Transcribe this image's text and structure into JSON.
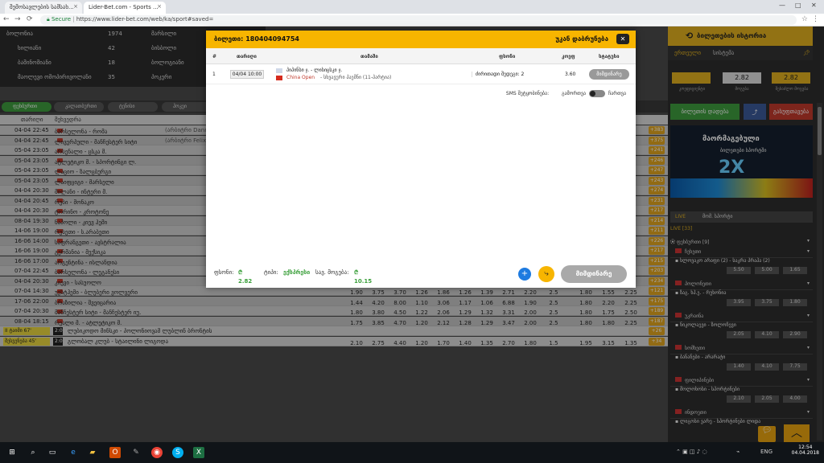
{
  "browser": {
    "tabs": [
      {
        "title": "შემოსავლების სამსახ..."
      },
      {
        "title": "Lider-Bet.com - Sports ..."
      }
    ],
    "address": {
      "secure": "Secure",
      "url": "https://www.lider-bet.com/web/ka/sport#saved="
    }
  },
  "topgrid": [
    {
      "name": "ბოლონია",
      "num": "1974"
    },
    {
      "name": "ხილიანი",
      "num": "42"
    },
    {
      "name": "ბამინომიანი",
      "num": "18"
    },
    {
      "name": "მაოლევი ომოპირივოლანი",
      "num": "35"
    }
  ],
  "topgrid_right": [
    "მარსილი",
    "ბისბოლი",
    "ბოლოგიანი",
    "პოკერი"
  ],
  "sport_tabs": [
    "ფეხბურთი",
    "კალათბურთი",
    "ტენისი",
    "ჰოკეი"
  ],
  "table_header": {
    "date": "თარიღი",
    "match": "შეხვედრა"
  },
  "matches": [
    {
      "date": "04-04 22:45",
      "name": "ბარსელონა - რომა",
      "note": "(არბიტრი Danny Makkelie)",
      "plus": "+383"
    },
    {
      "date": "04-04 22:45",
      "name": "ლივერპული - მანჩესტერ სიტი",
      "note": "(არბიტრი Felix Brych)",
      "plus": "+375"
    },
    {
      "date": "05-04 23:05",
      "name": "არსენალი - ცსკა მ.",
      "note": "",
      "plus": "+241"
    },
    {
      "date": "05-04 23:05",
      "name": "ატლეტიკო მ. - სპორტინგი ლ.",
      "note": "",
      "plus": "+246"
    },
    {
      "date": "05-04 23:05",
      "name": "ლაციო - ზალცბურგი",
      "note": "",
      "plus": "+247"
    },
    {
      "date": "05-04 23:05",
      "name": "ლაიფციგი - მარსელი",
      "note": "",
      "plus": "+243"
    },
    {
      "date": "04-04 20:30",
      "name": "მილანი - ინტერი მ.",
      "note": "",
      "plus": "+274"
    },
    {
      "date": "04-04 20:45",
      "name": "რუბი - მონაკო",
      "note": "",
      "plus": "+231"
    },
    {
      "date": "04-04 20:30",
      "name": "ტორინო - კროტონე",
      "note": "",
      "plus": "+217"
    },
    {
      "date": "08-04 19:30",
      "name": "ნაპოლი - კიევ ჰემი",
      "note": "",
      "plus": "+214"
    },
    {
      "date": "14-06 19:00",
      "name": "რუსეთი - ს.არაბეთი",
      "note": "",
      "plus": "+211"
    },
    {
      "date": "16-06 14:00",
      "name": "საფრანგეთი - ავსტრალია",
      "note": "",
      "plus": "+226"
    },
    {
      "date": "16-06 19:00",
      "name": "გერმანია - მექსიკა",
      "note": "",
      "plus": "+217"
    },
    {
      "date": "16-06 17:00",
      "name": "არგენტინა - ისლანდია",
      "note": "",
      "plus": "+215"
    },
    {
      "date": "07-04 22:45",
      "name": "ბარსელონა - ლეგანესი",
      "note": "",
      "plus": "+203"
    },
    {
      "date": "04-04 20:30",
      "name": "კიევი - სასუოლო",
      "note": "",
      "plus": "+234"
    },
    {
      "date": "07-04 14:30",
      "name": "უესტჰემი - ბლუბერი ვოლვერი",
      "note": "",
      "plus": "+121",
      "odds": [
        "1.90",
        "3.75",
        "3.70",
        "1.26",
        "1.86",
        "1.26",
        "1.39",
        "2.71",
        "2.20",
        "2.5",
        "1.80",
        "1.55",
        "2.25"
      ]
    },
    {
      "date": "17-06 22:00",
      "name": "ბრაზილია - შვეიცარია",
      "note": "",
      "plus": "+175",
      "odds": [
        "1.44",
        "4.20",
        "8.00",
        "1.10",
        "3.06",
        "1.17",
        "1.06",
        "6.88",
        "1.90",
        "2.5",
        "1.80",
        "2.20",
        "2.25"
      ]
    },
    {
      "date": "07-04 20:30",
      "name": "მანჩესტერ სიტი - მანჩესტერ იუ.",
      "note": "",
      "plus": "+189",
      "odds": [
        "1.80",
        "3.80",
        "4.50",
        "1.22",
        "2.06",
        "1.29",
        "1.32",
        "3.31",
        "2.00",
        "2.5",
        "1.80",
        "1.75",
        "2.50"
      ]
    },
    {
      "date": "08-04 18:15",
      "name": "რეალი მ. - ატლეტიკო მ.",
      "note": "",
      "plus": "+187",
      "odds": [
        "1.75",
        "3.85",
        "4.70",
        "1.20",
        "2.12",
        "1.28",
        "1.29",
        "3.47",
        "2.00",
        "2.5",
        "1.80",
        "1.80",
        "2.25"
      ]
    }
  ],
  "live_rows": [
    {
      "status": "II ტაიმი 67'",
      "score": "2:0",
      "name": "ლუბიკოდო მინსკი - პოლონიოვამ ლუბლინ ბრონტის",
      "plus": "+26"
    },
    {
      "status": "შესვენება 45'",
      "score": "2:0",
      "name": "გლობალ კლუბ - სტაილინი ლიგოდა",
      "plus": "+34",
      "odds": [
        "2.10",
        "2.75",
        "4.40",
        "1.20",
        "1.70",
        "1.40",
        "1.35",
        "2.70",
        "1.80",
        "1.5",
        "1.95",
        "3.15",
        "1.35"
      ]
    }
  ],
  "right_panel": {
    "title": "ბილეთების ისტორია",
    "tabs": [
      "ერთეული",
      "სისტემა"
    ],
    "values": [
      "2.82",
      "2.82"
    ],
    "labels": [
      "კოეფიციენტი",
      "მოგება",
      "შესაძლო მოგება"
    ],
    "save_btn": "ბილეთის დადება",
    "clear_btn": "გასუფთავება",
    "banner": {
      "title": "მაორმაგებული",
      "sub": "ბილეთები სპორტში",
      "big": "2X"
    },
    "live_tabs": [
      "LIVE",
      "მომ. სპორტი"
    ],
    "live_count": "LIVE [33]",
    "football": "ფეხბურთი [9]",
    "leagues": [
      {
        "country": "ჩეხეთი",
        "match": "სლოვაკო არაფი (2) - საკრა პრაჰა (2)",
        "odds": [
          "5.50",
          "5.00",
          "1.65"
        ]
      },
      {
        "country": "პოლონეთი",
        "match": "ზაგ. ხჰ.ე. - რუხონია",
        "odds": [
          "3.95",
          "3.75",
          "1.80"
        ]
      },
      {
        "country": "უკრაინა",
        "match": "ნიკოლაევი - ზოლოჩევი",
        "odds": [
          "2.05",
          "4.10",
          "2.90"
        ]
      },
      {
        "country": "სომხეთი",
        "match": "ბანანები - არარატი",
        "odds": [
          "1.40",
          "4.10",
          "7.75"
        ]
      },
      {
        "country": "ფილიპინები",
        "match": "მოლოხოსი - სპორტინები",
        "odds": [
          "2.10",
          "2.05",
          "4.00"
        ]
      },
      {
        "country": "ინდოეთი",
        "match": "ლიგოსი ვარე - სპორტინები ლიდა",
        "odds": []
      }
    ]
  },
  "modal": {
    "ticket_label": "ბილეთი:",
    "ticket_id": "180404094754",
    "back": "უკან დაბრუნება",
    "close": "✕",
    "columns": [
      "#",
      "თარიღი",
      "თამაში",
      "ფსონი",
      "კოეფ",
      "სტატუსი"
    ],
    "row": {
      "num": "1",
      "date": "04/04 10:00",
      "game": "პიპინსი ჯ. - ლისიცსკი ჯ.",
      "league": "China Open",
      "league_suffix": "- სხვავური პაემნი (11-პარტია)",
      "bet": "ძირითადი შედეგი: 2",
      "odds": "3.60",
      "status": "მიმდინარე"
    },
    "sms_label": "SMS შეტყობინება:",
    "sms_off": "გამორთვა",
    "sms_on": "ჩართვა",
    "footer": {
      "stake_label": "ფსონი:",
      "stake": "2.82",
      "type_label": "ტიპი:",
      "type": "ექსპრესი",
      "win_label": "სავ. მოგება:",
      "win": "10.15",
      "main_btn": "მიმდინარე"
    }
  },
  "taskbar": {
    "lang": "ENG",
    "time": "12:54",
    "date": "04.04.2018"
  }
}
